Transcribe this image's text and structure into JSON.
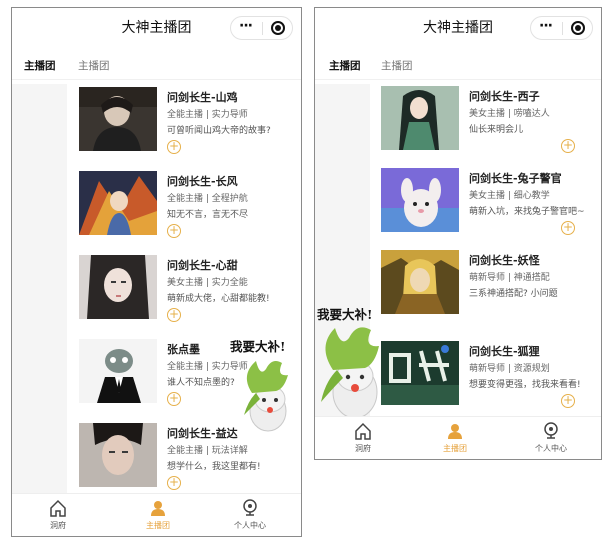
{
  "left": {
    "title": "大神主播团",
    "tabs": [
      "主播团",
      "主播团"
    ],
    "cards": [
      {
        "name": "问剑长生-山鸡",
        "tags": "全能主播 | 实力导师",
        "desc": "可曾听闻山鸡大帝的故事?"
      },
      {
        "name": "问剑长生-长风",
        "tags": "全能主播 | 全程护航",
        "desc": "知无不言，言无不尽"
      },
      {
        "name": "问剑长生-心甜",
        "tags": "美女主播 | 实力全能",
        "desc": "萌新成大佬，心甜都能教!"
      },
      {
        "name": "张点墨",
        "tags": "全能主播 | 实力导师",
        "desc": "谁人不知点墨的?"
      },
      {
        "name": "问剑长生-益达",
        "tags": "全能主播 | 玩法详解",
        "desc": "想学什么，我这里都有!"
      }
    ],
    "slogan": "我要大补!",
    "nav": [
      "洞府",
      "主播团",
      "个人中心"
    ]
  },
  "right": {
    "title": "大神主播团",
    "tabs": [
      "主播团",
      "主播团"
    ],
    "cards": [
      {
        "name": "问剑长生-西子",
        "tags": "美女主播 | 唠嗑达人",
        "desc": "仙长来明会儿"
      },
      {
        "name": "问剑长生-兔子警官",
        "tags": "美女主播 | 细心教学",
        "desc": "萌新入坑，来找兔子警官吧~"
      },
      {
        "name": "问剑长生-妖怪",
        "tags": "萌新导师 | 神通搭配",
        "desc": "三系神通搭配? 小问题"
      },
      {
        "name": "问剑长生-狐狸",
        "tags": "萌新导师 | 资源规划",
        "desc": "想要变得更强，找我来看看!"
      }
    ],
    "slogan": "我要大补!",
    "nav": [
      "洞府",
      "主播团",
      "个人中心"
    ]
  },
  "icons": {
    "more": "···",
    "add": "+"
  },
  "colors": {
    "accent": "#e6a23c",
    "sidebar": "#f5f5f5"
  }
}
